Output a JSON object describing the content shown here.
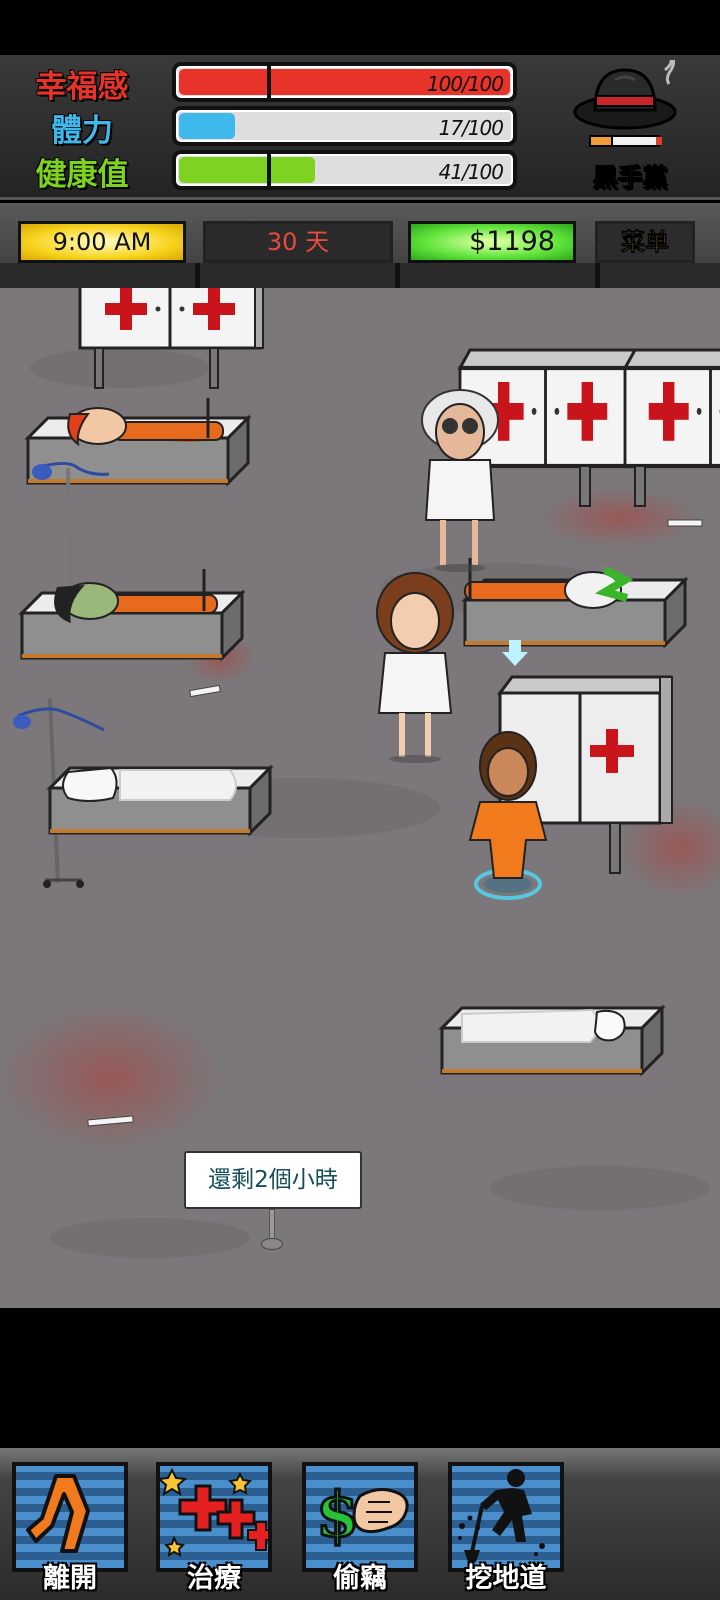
{
  "stats": {
    "happiness": {
      "label": "幸福感",
      "value_text": "100/100",
      "fraction": 1.0,
      "color": "#e8332b"
    },
    "stamina": {
      "label": "體力",
      "value_text": "17/100",
      "fraction": 0.17,
      "color": "#3fb8ec"
    },
    "health": {
      "label": "健康值",
      "value_text": "41/100",
      "fraction": 0.41,
      "color": "#7ed321"
    }
  },
  "gang": {
    "label": "黑手黨",
    "icon": "fedora-hat-cigarette-icon"
  },
  "info": {
    "time": "9:00 AM",
    "day": "30 天",
    "money": "$1198",
    "menu": "菜单"
  },
  "scene": {
    "timer_sign": "還剩2個小時",
    "interaction_marker": "down-arrow-icon"
  },
  "actions": [
    {
      "label": "離開",
      "icon": "walking-legs-icon"
    },
    {
      "label": "治療",
      "icon": "red-cross-plus-icon"
    },
    {
      "label": "偷竊",
      "icon": "dollar-grab-hand-icon"
    },
    {
      "label": "挖地道",
      "icon": "digging-man-icon"
    }
  ]
}
